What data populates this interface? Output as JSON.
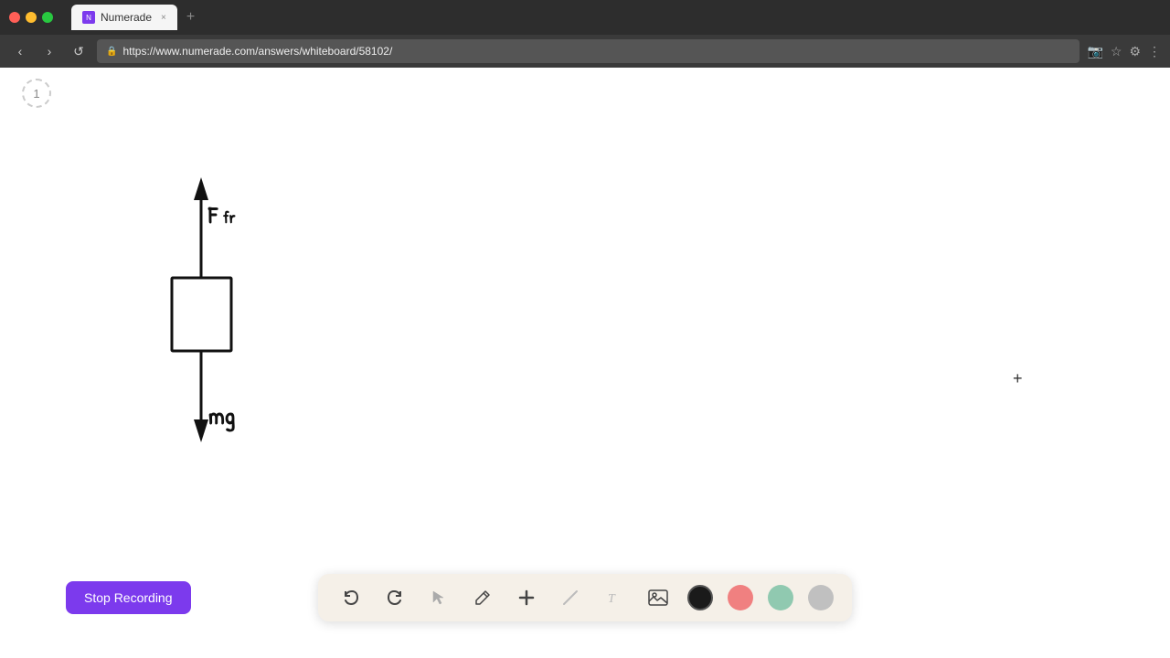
{
  "browser": {
    "controls": {
      "red_dot": "close",
      "yellow_dot": "minimize",
      "green_dot": "maximize"
    },
    "tab": {
      "favicon_letter": "N",
      "title": "Numerade",
      "close_label": "×",
      "new_tab_label": "+"
    },
    "address": {
      "url": "https://www.numerade.com/answers/whiteboard/58102/",
      "lock_icon": "🔒"
    },
    "nav": {
      "back": "‹",
      "forward": "›",
      "refresh": "↺"
    }
  },
  "page_indicator": {
    "number": "1"
  },
  "cursor": {
    "symbol": "+"
  },
  "toolbar": {
    "undo_label": "↩",
    "redo_label": "↪",
    "select_icon": "▲",
    "pen_icon": "✏",
    "add_icon": "+",
    "eraser_icon": "/",
    "text_icon": "T",
    "image_icon": "🖼",
    "colors": [
      {
        "name": "black",
        "hex": "#1a1a1a",
        "active": true
      },
      {
        "name": "pink",
        "hex": "#f08080"
      },
      {
        "name": "mint",
        "hex": "#90c9b0"
      },
      {
        "name": "gray",
        "hex": "#b0b0b0"
      }
    ]
  },
  "stop_recording": {
    "label": "Stop Recording"
  }
}
